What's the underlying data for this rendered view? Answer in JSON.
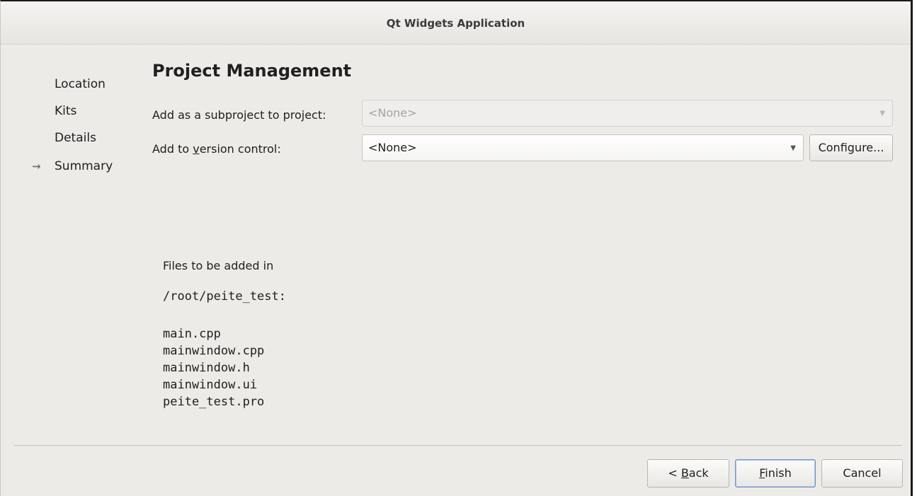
{
  "window": {
    "title": "Qt Widgets Application"
  },
  "sidebar": {
    "items": [
      {
        "label": "Location",
        "current": false
      },
      {
        "label": "Kits",
        "current": false
      },
      {
        "label": "Details",
        "current": false
      },
      {
        "label": "Summary",
        "current": true
      }
    ],
    "current_marker": "⇝"
  },
  "page": {
    "title": "Project Management"
  },
  "form": {
    "subproject_label": "Add as a subproject to project:",
    "subproject_value": "<None>",
    "vcs_label_prefix": "Add to ",
    "vcs_label_mnemonic": "v",
    "vcs_label_suffix": "ersion control:",
    "vcs_value": "<None>",
    "configure_label": "Configure..."
  },
  "files": {
    "header": "Files to be added in",
    "directory": "/root/peite_test:",
    "list": [
      "main.cpp",
      "mainwindow.cpp",
      "mainwindow.h",
      "mainwindow.ui",
      "peite_test.pro"
    ]
  },
  "buttons": {
    "back_prefix": "< ",
    "back_mnemonic": "B",
    "back_suffix": "ack",
    "finish_mnemonic": "F",
    "finish_suffix": "inish",
    "cancel": "Cancel"
  },
  "icons": {
    "dropdown": "chevron-down-icon",
    "current_step": "double-arrow-right-icon"
  },
  "colors": {
    "window_bg": "#edebe8",
    "default_button_border": "#6f96c4"
  }
}
